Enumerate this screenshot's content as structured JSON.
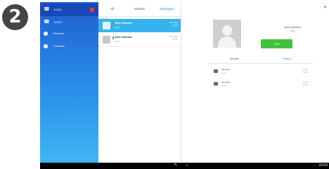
{
  "step_badge": "2",
  "sidebar": {
    "accounts": [
      {
        "label": "111111"
      },
      {
        "label": "111112"
      }
    ],
    "nav": [
      {
        "label": "Recents",
        "icon": "clock-icon"
      },
      {
        "label": "Contacts",
        "icon": "person-icon"
      }
    ]
  },
  "tabs": {
    "all": "All",
    "missed": "Missed",
    "messages": "Messages"
  },
  "list": {
    "section_label": "Jane D...",
    "rows": [
      {
        "name": "Jane Dawson",
        "sub": "Hello",
        "meta_1": "Message",
        "meta_2": "15:50"
      },
      {
        "name": "Jane Dawson",
        "sub": "Hello",
        "meta_1": "Message",
        "meta_2": "15:50"
      }
    ]
  },
  "detail": {
    "contact_name": "Jane Dawson",
    "contact_sub": "Hello",
    "call_label": "Call",
    "subtab_details": "Details",
    "subtab_history": "History",
    "history": [
      {
        "title": "Message",
        "sub": "Hello",
        "meta_1": "Today",
        "meta_2": "15:50"
      },
      {
        "title": "Message",
        "sub": "Hello",
        "meta_1": "Today",
        "meta_2": "15:50"
      }
    ]
  },
  "system_bar": {
    "left": "........",
    "status": "2",
    "clock": "15:53"
  },
  "colors": {
    "accent": "#2196f3",
    "selection": "#35b4ef",
    "call_green": "#43c03f",
    "sidebar_top": "#1f5fd0",
    "sidebar_bottom": "#3fb6f2"
  }
}
